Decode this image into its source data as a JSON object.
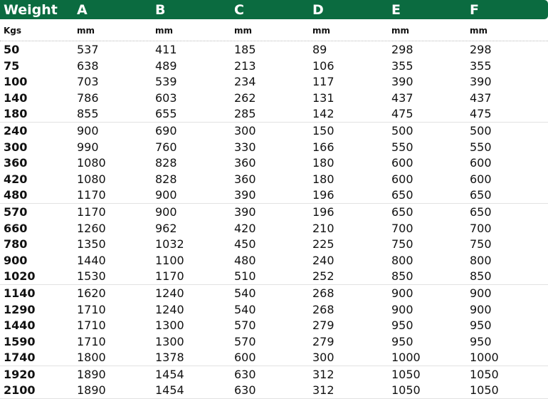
{
  "header": [
    "Weight",
    "A",
    "B",
    "C",
    "D",
    "E",
    "F"
  ],
  "units": [
    "Kgs",
    "mm",
    "mm",
    "mm",
    "mm",
    "mm",
    "mm"
  ],
  "groups": [
    [
      [
        "50",
        "537",
        "411",
        "185",
        "89",
        "298",
        "298"
      ],
      [
        "75",
        "638",
        "489",
        "213",
        "106",
        "355",
        "355"
      ],
      [
        "100",
        "703",
        "539",
        "234",
        "117",
        "390",
        "390"
      ],
      [
        "140",
        "786",
        "603",
        "262",
        "131",
        "437",
        "437"
      ],
      [
        "180",
        "855",
        "655",
        "285",
        "142",
        "475",
        "475"
      ]
    ],
    [
      [
        "240",
        "900",
        "690",
        "300",
        "150",
        "500",
        "500"
      ],
      [
        "300",
        "990",
        "760",
        "330",
        "166",
        "550",
        "550"
      ],
      [
        "360",
        "1080",
        "828",
        "360",
        "180",
        "600",
        "600"
      ],
      [
        "420",
        "1080",
        "828",
        "360",
        "180",
        "600",
        "600"
      ],
      [
        "480",
        "1170",
        "900",
        "390",
        "196",
        "650",
        "650"
      ]
    ],
    [
      [
        "570",
        "1170",
        "900",
        "390",
        "196",
        "650",
        "650"
      ],
      [
        "660",
        "1260",
        "962",
        "420",
        "210",
        "700",
        "700"
      ],
      [
        "780",
        "1350",
        "1032",
        "450",
        "225",
        "750",
        "750"
      ],
      [
        "900",
        "1440",
        "1100",
        "480",
        "240",
        "800",
        "800"
      ],
      [
        "1020",
        "1530",
        "1170",
        "510",
        "252",
        "850",
        "850"
      ]
    ],
    [
      [
        "1140",
        "1620",
        "1240",
        "540",
        "268",
        "900",
        "900"
      ],
      [
        "1290",
        "1710",
        "1240",
        "540",
        "268",
        "900",
        "900"
      ],
      [
        "1440",
        "1710",
        "1300",
        "570",
        "279",
        "950",
        "950"
      ],
      [
        "1590",
        "1710",
        "1300",
        "570",
        "279",
        "950",
        "950"
      ],
      [
        "1740",
        "1800",
        "1378",
        "600",
        "300",
        "1000",
        "1000"
      ]
    ],
    [
      [
        "1920",
        "1890",
        "1454",
        "630",
        "312",
        "1050",
        "1050"
      ],
      [
        "2100",
        "1890",
        "1454",
        "630",
        "312",
        "1050",
        "1050"
      ]
    ]
  ],
  "colors": {
    "header_bg": "#0b6b40",
    "header_text": "#ffffff",
    "body_text": "#111111"
  }
}
